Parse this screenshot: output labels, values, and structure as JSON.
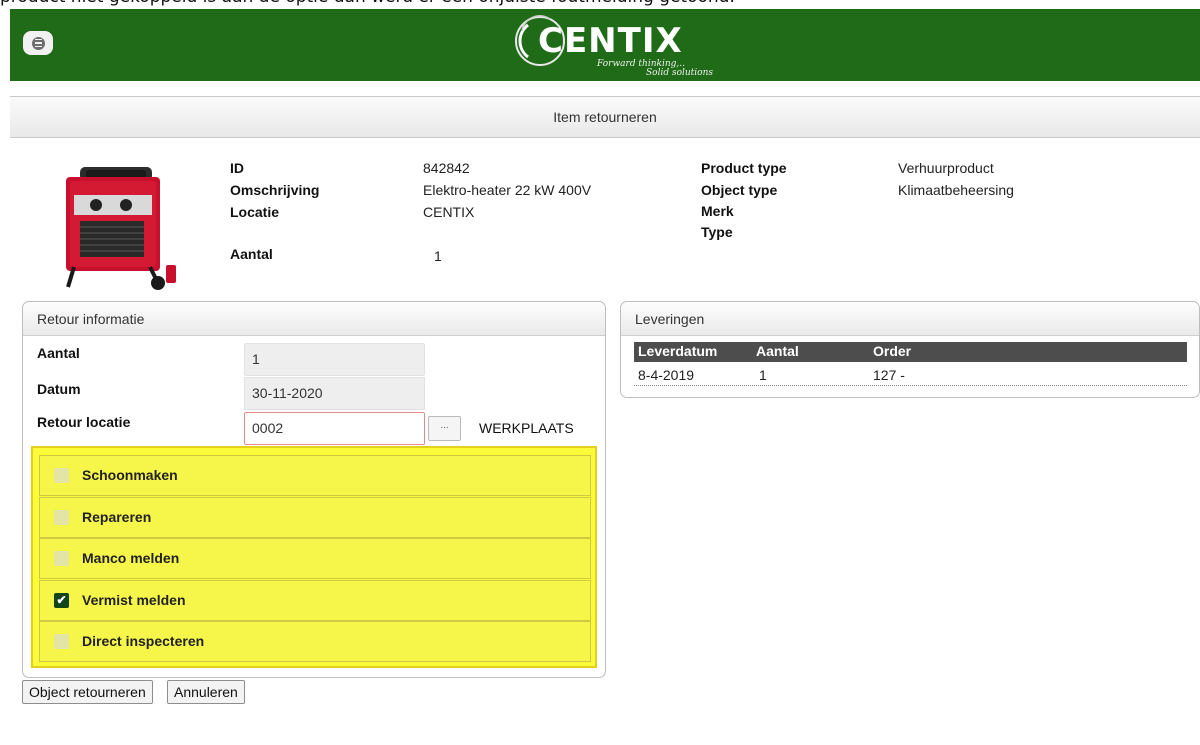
{
  "caption": "product niet gekoppeld is aan de optie dan werd er een onjuiste foutmelding getoond.",
  "header": {
    "menu_icon": "menu-icon",
    "logo": {
      "brand": "CENTIX",
      "tagline_1": "Forward thinking,..",
      "tagline_2": "Solid solutions"
    },
    "color": "#1f6b18"
  },
  "page_title": "Item retourneren",
  "item": {
    "image_icon": "electric-heater-image",
    "left": [
      {
        "label": "ID",
        "value": "842842"
      },
      {
        "label": "Omschrijving",
        "value": "Elektro-heater 22 kW 400V"
      },
      {
        "label": "Locatie",
        "value": "CENTIX"
      },
      {
        "label": "Aantal",
        "value": "1"
      }
    ],
    "right": [
      {
        "label": "Product type",
        "value": "Verhuurproduct"
      },
      {
        "label": "Object type",
        "value": "Klimaatbeheersing"
      },
      {
        "label": "Merk",
        "value": ""
      },
      {
        "label": "Type",
        "value": ""
      }
    ]
  },
  "return_info": {
    "title": "Retour informatie",
    "fields": {
      "aantal": {
        "label": "Aantal",
        "value": "1"
      },
      "datum": {
        "label": "Datum",
        "value": "30-11-2020"
      },
      "retour_locatie": {
        "label": "Retour locatie",
        "value": "0002",
        "browse_label": "...",
        "location_name": "WERKPLAATS"
      }
    },
    "options": [
      {
        "label": "Schoonmaken",
        "checked": false
      },
      {
        "label": "Repareren",
        "checked": false
      },
      {
        "label": "Manco melden",
        "checked": false
      },
      {
        "label": "Vermist melden",
        "checked": true,
        "check_mark": "✔"
      },
      {
        "label": "Direct inspecteren",
        "checked": false
      }
    ],
    "highlight_color": "#fbfb3a"
  },
  "deliveries": {
    "title": "Leveringen",
    "columns": [
      "Leverdatum",
      "Aantal",
      "Order"
    ],
    "rows": [
      [
        "8-4-2019",
        "1",
        "127 -"
      ]
    ]
  },
  "actions": {
    "return_label": "Object retourneren",
    "cancel_label": "Annuleren"
  }
}
